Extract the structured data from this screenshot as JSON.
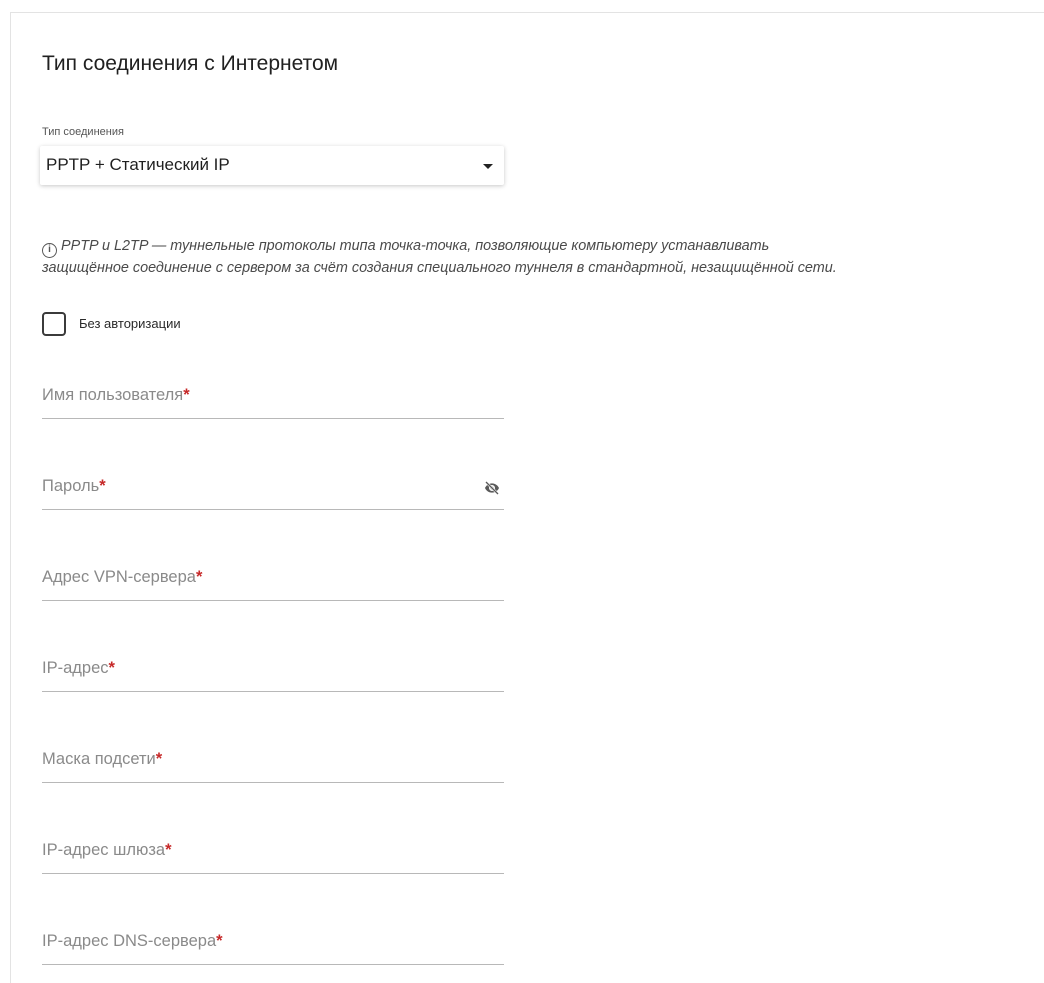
{
  "section": {
    "title": "Тип соединения с Интернетом"
  },
  "connection_type": {
    "label": "Тип соединения",
    "value": "PPTP + Статический IP",
    "caret_icon": "caret-down-icon"
  },
  "info": {
    "icon": "info-icon",
    "icon_glyph": "i",
    "text_line1": "PPTP и L2TP — туннельные протоколы типа точка-точка, позволяющие компьютеру устанавливать",
    "text_line2": "защищённое соединение с сервером за счёт создания специального туннеля в стандартной, незащищённой сети."
  },
  "no_auth": {
    "label": "Без авторизации",
    "checked": false
  },
  "fields": {
    "required_mark": "*",
    "username": {
      "label": "Имя пользователя"
    },
    "password": {
      "label": "Пароль",
      "toggle_icon": "eye-off-icon"
    },
    "vpn_server": {
      "label": "Адрес VPN-сервера"
    },
    "ip": {
      "label": "IP-адрес"
    },
    "subnet_mask": {
      "label": "Маска подсети"
    },
    "gateway": {
      "label": "IP-адрес шлюза"
    },
    "dns": {
      "label": "IP-адрес DNS-сервера"
    }
  },
  "colors": {
    "required": "#c62828",
    "label": "#8a8a8a",
    "underline": "#b8b8b8"
  }
}
